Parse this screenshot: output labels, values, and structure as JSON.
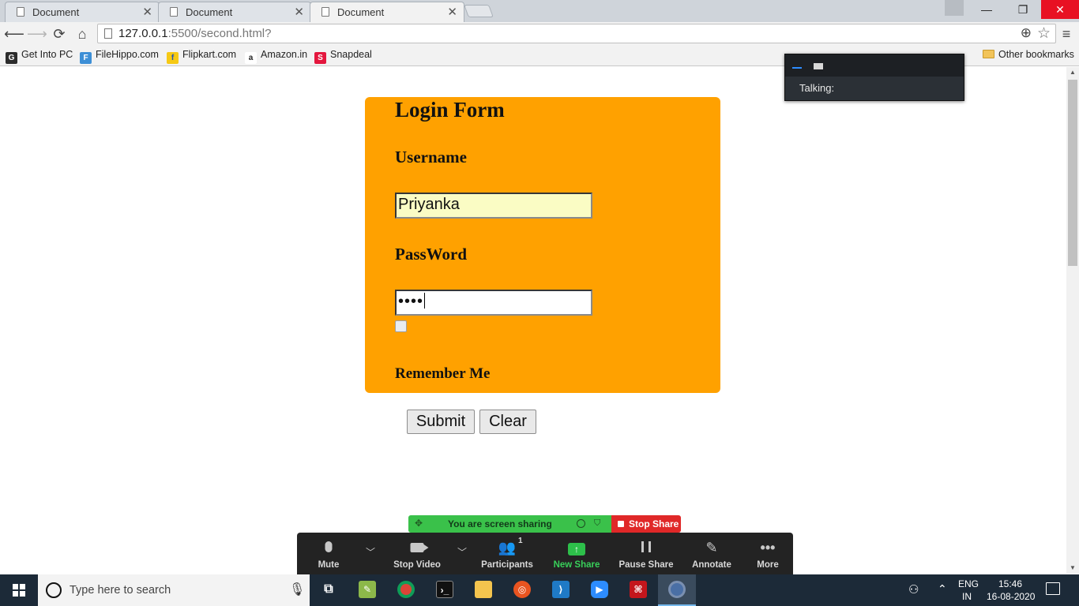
{
  "browser": {
    "tabs": [
      {
        "title": "Document",
        "close": "✕"
      },
      {
        "title": "Document",
        "close": "✕"
      },
      {
        "title": "Document",
        "close": "✕"
      }
    ],
    "window_controls": {
      "minimize": "—",
      "restore": "❐",
      "close": "✕"
    },
    "url_host": "127.0.0.1",
    "url_path": ":5500/second.html?",
    "bookmarks": [
      {
        "label": "Get Into PC",
        "icon": "G",
        "color": "#2c2c2c"
      },
      {
        "label": "FileHippo.com",
        "icon": "F",
        "color": "#3d8fd6"
      },
      {
        "label": "Flipkart.com",
        "icon": "f",
        "color": "#f6c915"
      },
      {
        "label": "Amazon.in",
        "icon": "a",
        "color": "#222222"
      },
      {
        "label": "Snapdeal",
        "icon": "S",
        "color": "#e4173e"
      }
    ],
    "other_bookmarks": "Other bookmarks"
  },
  "form": {
    "title": "Login Form",
    "username_label": "Username",
    "username_value": "Priyanka",
    "password_label": "PassWord",
    "password_mask": "••••",
    "remember_label": "Remember Me",
    "submit_label": "Submit",
    "clear_label": "Clear",
    "accent_color": "#ffa100"
  },
  "zoom": {
    "talking_label": "Talking:",
    "sharing_text": "You are screen sharing",
    "stop_share_label": "Stop Share",
    "participants_count": "1",
    "toolbar": [
      {
        "label": "Mute",
        "icon": "microphone-icon"
      },
      {
        "label": "Stop Video",
        "icon": "video-camera-icon"
      },
      {
        "label": "Participants",
        "icon": "participants-icon"
      },
      {
        "label": "New Share",
        "icon": "share-screen-icon"
      },
      {
        "label": "Pause Share",
        "icon": "pause-icon"
      },
      {
        "label": "Annotate",
        "icon": "pencil-icon"
      },
      {
        "label": "More",
        "icon": "more-dots-icon"
      }
    ]
  },
  "taskbar": {
    "search_placeholder": "Type here to search",
    "language_top": "ENG",
    "language_bottom": "IN",
    "time": "15:46",
    "date": "16-08-2020"
  }
}
